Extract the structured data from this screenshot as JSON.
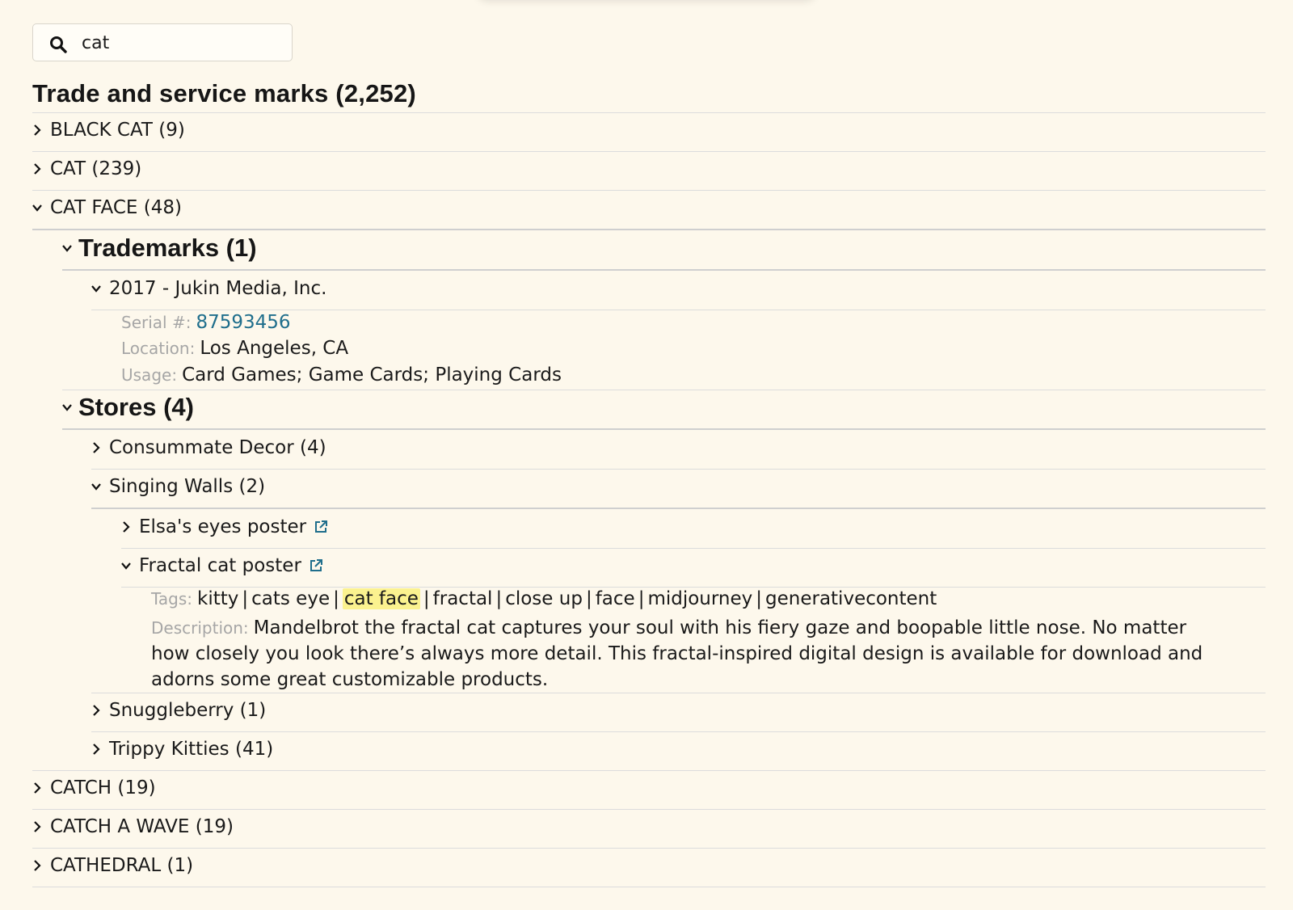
{
  "search": {
    "value": "cat",
    "placeholder": ""
  },
  "heading": {
    "title": "Trade and service marks (2,252)"
  },
  "marks": [
    {
      "label": "BLACK CAT (9)"
    },
    {
      "label": "CAT (239)"
    },
    {
      "label": "CAT FACE (48)"
    },
    {
      "label": "CATCH (19)"
    },
    {
      "label": "CATCH A WAVE (19)"
    },
    {
      "label": "CATHEDRAL (1)"
    }
  ],
  "trademarks": {
    "title": "Trademarks (1)",
    "entry": {
      "label": "2017 - Jukin Media, Inc.",
      "serial_label": "Serial #:",
      "serial": "87593456",
      "location_label": "Location:",
      "location": "Los Angeles, CA",
      "usage_label": "Usage:",
      "usage": "Card Games; Game Cards; Playing Cards"
    }
  },
  "stores": {
    "title": "Stores (4)",
    "items": [
      {
        "label": "Consummate Decor (4)"
      },
      {
        "label": "Singing Walls (2)"
      },
      {
        "label": "Snuggleberry (1)"
      },
      {
        "label": "Trippy Kitties (41)"
      }
    ],
    "singing_walls_products": [
      {
        "label": "Elsa's eyes poster"
      },
      {
        "label": "Fractal cat poster"
      }
    ]
  },
  "product": {
    "tags_label": "Tags:",
    "tags": [
      "kitty",
      "cats eye",
      "cat face",
      "fractal",
      "close up",
      "face",
      "midjourney",
      "generativecontent"
    ],
    "highlighted_tag": "cat face",
    "description_label": "Description:",
    "description": "Mandelbrot the fractal cat captures your soul with his fiery gaze and boopable little nose. No matter how closely you look there’s always more detail. This fractal-inspired digital design is available for download and adorns some great customizable products."
  },
  "colors": {
    "background": "#fdf8ec",
    "link": "#1f6e8c",
    "highlight": "#fbf28f",
    "muted_label": "#a6a6a6"
  }
}
